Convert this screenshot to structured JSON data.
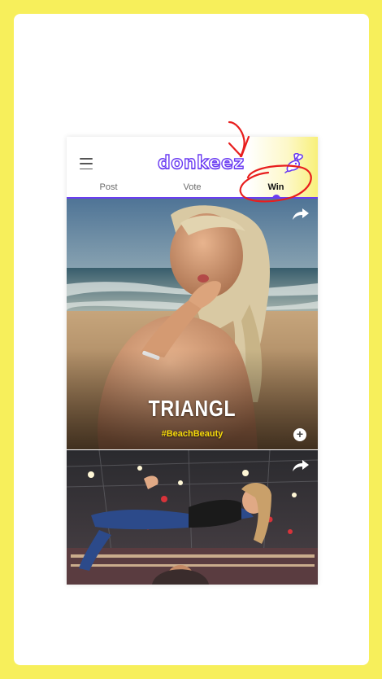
{
  "app": {
    "logo_text": "donkeez"
  },
  "tabs": [
    {
      "label": "Post",
      "active": false
    },
    {
      "label": "Vote",
      "active": false
    },
    {
      "label": "Win",
      "active": true
    }
  ],
  "feed": [
    {
      "brand": "TRIANGL",
      "hashtag": "#BeachBeauty"
    },
    {
      "brand": "",
      "hashtag": ""
    }
  ],
  "colors": {
    "outer_background": "#f7ef5b",
    "accent": "#6a3cf2",
    "hashtag": "#f5d90a",
    "annotation": "#e81e1e"
  },
  "icons": {
    "menu": "hamburger-menu-icon",
    "profile": "rabbit-mascot-icon",
    "share": "share-arrow-icon",
    "add": "plus-icon"
  }
}
